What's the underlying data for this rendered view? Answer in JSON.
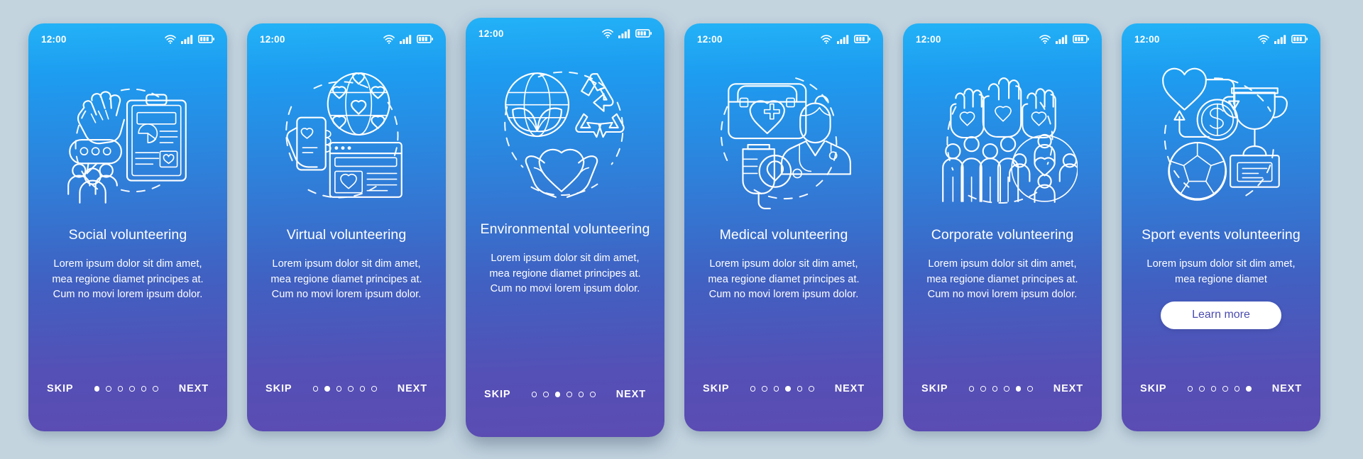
{
  "page": {
    "background_color": "#c3d4df",
    "card_gradient_top": "#23b2f7",
    "card_gradient_bottom": "#5b4cb2",
    "button_text_color": "#4b4bb0",
    "accent_white": "#ffffff",
    "total_steps": 6
  },
  "statusbar": {
    "time": "12:00",
    "icons": [
      "wifi-icon",
      "signal-icon",
      "battery-icon"
    ]
  },
  "nav": {
    "skip_label": "SKIP",
    "next_label": "NEXT"
  },
  "screens": [
    {
      "id": "social",
      "illustration": "social-volunteering-illustration",
      "illustration_parts": [
        "clapping-hands-icon",
        "speech-bubble-icon",
        "people-group-icon",
        "clipboard-report-icon"
      ],
      "title": "Social volunteering",
      "description": "Lorem ipsum dolor sit dim amet, mea regione diamet principes at. Cum no movi lorem ipsum dolor.",
      "active_step": 1,
      "has_button": false,
      "button_label": ""
    },
    {
      "id": "virtual",
      "illustration": "virtual-volunteering-illustration",
      "illustration_parts": [
        "phone-donate-icon",
        "globe-hearts-icon",
        "browser-window-icon"
      ],
      "title": "Virtual volunteering",
      "description": "Lorem ipsum dolor sit dim amet, mea regione diamet principes at. Cum no movi lorem ipsum dolor.",
      "active_step": 2,
      "has_button": false,
      "button_label": ""
    },
    {
      "id": "environmental",
      "illustration": "environmental-volunteering-illustration",
      "illustration_parts": [
        "globe-leaves-icon",
        "recycle-icon",
        "heart-in-hands-icon"
      ],
      "title": "Environmental volunteering",
      "description": "Lorem ipsum dolor sit dim amet, mea regione diamet principes at. Cum no movi lorem ipsum dolor.",
      "active_step": 3,
      "has_button": false,
      "button_label": ""
    },
    {
      "id": "medical",
      "illustration": "medical-volunteering-illustration",
      "illustration_parts": [
        "first-aid-kit-icon",
        "blood-bag-icon",
        "doctor-icon"
      ],
      "title": "Medical volunteering",
      "description": "Lorem ipsum dolor sit dim amet, mea regione diamet principes at. Cum no movi lorem ipsum dolor.",
      "active_step": 4,
      "has_button": false,
      "button_label": ""
    },
    {
      "id": "corporate",
      "illustration": "corporate-volunteering-illustration",
      "illustration_parts": [
        "raised-hands-hearts-icon",
        "people-group-icon",
        "team-circle-heart-icon"
      ],
      "title": "Corporate volunteering",
      "description": "Lorem ipsum dolor sit dim amet, mea regione diamet principes at. Cum no movi lorem ipsum dolor.",
      "active_step": 5,
      "has_button": false,
      "button_label": ""
    },
    {
      "id": "sport-events",
      "illustration": "sport-events-volunteering-illustration",
      "illustration_parts": [
        "heart-icon",
        "dollar-coin-icon",
        "soccer-ball-icon",
        "trophy-icon"
      ],
      "title": "Sport events volunteering",
      "description": "Lorem ipsum dolor sit dim amet, mea regione diamet",
      "active_step": 6,
      "has_button": true,
      "button_label": "Learn more"
    }
  ]
}
